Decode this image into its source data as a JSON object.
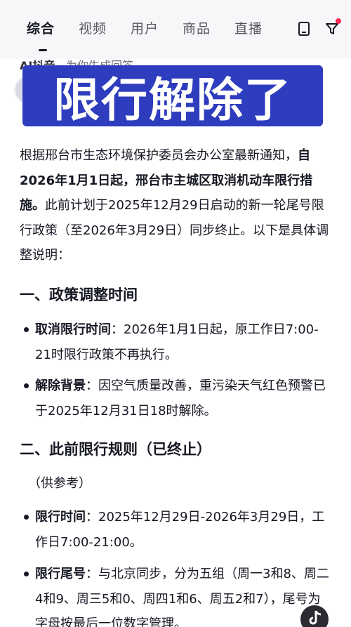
{
  "tabs": [
    {
      "label": "综合",
      "active": true
    },
    {
      "label": "视频",
      "active": false
    },
    {
      "label": "用户",
      "active": false
    },
    {
      "label": "商品",
      "active": false
    },
    {
      "label": "直播",
      "active": false
    }
  ],
  "toolbar": {
    "device_icon": "tablet-icon",
    "filter_icon": "filter-icon"
  },
  "ai_header": {
    "name": "AI抖音",
    "subtitle": "为你生成回答"
  },
  "banner": {
    "text": "限行解除了"
  },
  "intro": {
    "part1": "根据邢台市生态环境保护委员会办公室最新通知，",
    "part_bold": "自2026年1月1日起，邢台市主城区取消机动车限行措施。",
    "part2": "此前计划于2025年12月29日启动的新一轮尾号限行政策（至2026年3月29日）同步终止。以下是具体调整说明："
  },
  "section1": {
    "heading": "一、政策调整时间",
    "items": [
      {
        "label": "取消限行时间",
        "text": "：2026年1月1日起，原工作日7:00-21时限行政策不再执行。"
      },
      {
        "label": "解除背景",
        "text": "：因空气质量改善，重污染天气红色预警已于2025年12月31日18时解除。"
      }
    ]
  },
  "section2": {
    "heading": "二、此前限行规则（已终止）",
    "note": "（供参考）",
    "items": [
      {
        "label": "限行时间",
        "text": "：2025年12月29日-2026年3月29日，工作日7:00-21:00。"
      },
      {
        "label": "限行尾号",
        "text": "：与北京同步，分为五组（周一3和8、周二4和9、周三5和0、周四1和6、周五2和7），尾号为字母按最后一位数字管理。"
      }
    ]
  },
  "colors": {
    "banner_bg": "#2e3dbe",
    "text": "#161823",
    "accent_dot": "#fe2c55"
  }
}
